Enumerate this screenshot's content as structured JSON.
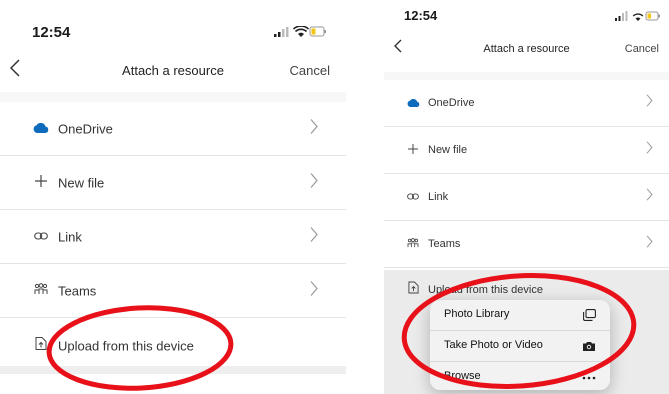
{
  "left": {
    "status": {
      "time": "12:54"
    },
    "nav": {
      "back": "<",
      "title": "Attach a resource",
      "cancel": "Cancel"
    },
    "items": [
      {
        "label": "OneDrive"
      },
      {
        "label": "New file"
      },
      {
        "label": "Link"
      },
      {
        "label": "Teams"
      }
    ],
    "upload": {
      "label": "Upload from this device"
    }
  },
  "right": {
    "status": {
      "time": "12:54"
    },
    "nav": {
      "back": "<",
      "title": "Attach a resource",
      "cancel": "Cancel"
    },
    "items": [
      {
        "label": "OneDrive"
      },
      {
        "label": "New file"
      },
      {
        "label": "Link"
      },
      {
        "label": "Teams"
      }
    ],
    "upload": {
      "label": "Upload from this device"
    },
    "popover": [
      {
        "label": "Photo Library",
        "icon": "photo-library-icon"
      },
      {
        "label": "Take Photo or Video",
        "icon": "camera-icon"
      },
      {
        "label": "Browse",
        "icon": "more-icon"
      }
    ]
  },
  "colors": {
    "onedrive": "#0F6CBD",
    "annotation": "#E8111A",
    "battery": "#F5C518"
  }
}
